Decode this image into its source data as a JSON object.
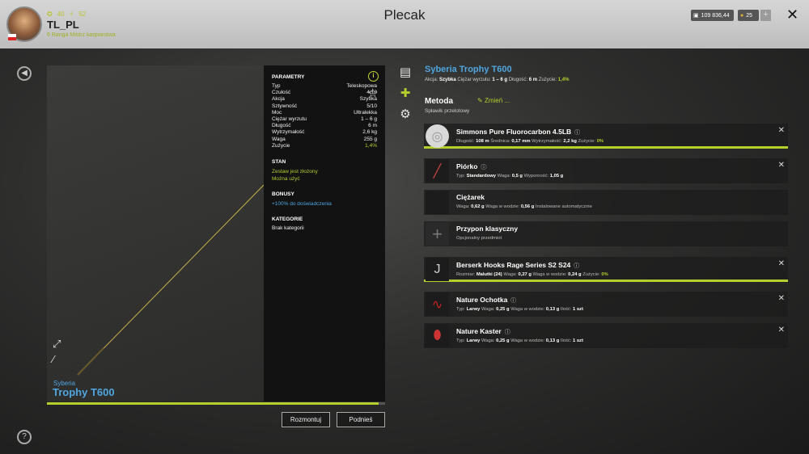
{
  "header": {
    "title": "Plecak",
    "username": "TL_PL",
    "level_stat": "40",
    "bolt_stat": "52",
    "rank": "6 Ranga Mistrz karpiarstwa",
    "money": "109 836,44",
    "gold": "25",
    "plus_label": "+",
    "close_label": "✕"
  },
  "preview": {
    "brand": "Syberia",
    "model": "Trophy T600",
    "durability_fraction": 0.98
  },
  "params": {
    "heading": "PARAMETRY",
    "rows": [
      {
        "label": "Typ",
        "value": "Teleskopowa"
      },
      {
        "label": "Czułość",
        "value": "4/10"
      },
      {
        "label": "Akcja",
        "value": "Szybka"
      },
      {
        "label": "Sztywność",
        "value": "5/10"
      },
      {
        "label": "Moc",
        "value": "Ultralekka"
      },
      {
        "label": "Ciężar wyrzutu",
        "value": "1 – 6 g"
      },
      {
        "label": "Długość",
        "value": "6 m"
      },
      {
        "label": "Wytrzymałość",
        "value": "2,6 kg"
      },
      {
        "label": "Waga",
        "value": "255 g"
      },
      {
        "label": "Zużycie",
        "value": "1,4%"
      }
    ],
    "stan_heading": "STAN",
    "stan_line1": "Zestaw jest złożony",
    "stan_line2": "Można użyć",
    "bonus_heading": "BONUSY",
    "bonus_line": "+100% do doświadczenia",
    "kategorie_heading": "KATEGORIE",
    "kategorie_line": "Brak kategorii"
  },
  "buttons": {
    "disassemble": "Rozmontuj",
    "pickup": "Podnieś"
  },
  "details": {
    "rod_name": "Syberia Trophy T600",
    "stats": [
      {
        "label": "Akcja:",
        "value": "Szybka"
      },
      {
        "label": "Ciężar wyrzutu:",
        "value": "1 – 6 g"
      },
      {
        "label": "Długość:",
        "value": "6 m"
      },
      {
        "label": "Zużycie:",
        "value": "1,4%"
      }
    ],
    "metoda_label": "Metoda",
    "change_label": "Zmień ...",
    "metoda_value": "Spławik przelotowy"
  },
  "slots": [
    {
      "name": "Simmons Pure Fluorocarbon 4.5LB",
      "details": [
        [
          "Długość:",
          "108 m"
        ],
        [
          "Średnica:",
          "0,17 mm"
        ],
        [
          "Wytrzymałość:",
          "2,2 kg"
        ],
        [
          "Zużycie:",
          "0%"
        ]
      ],
      "removable": true,
      "icon": "line-spool-icon"
    },
    {
      "name": "Piórko",
      "details": [
        [
          "Typ:",
          "Standardowy"
        ],
        [
          "Waga:",
          "0,5 g"
        ],
        [
          "Wyporność:",
          "1,05 g"
        ]
      ],
      "removable": true,
      "icon": "float-icon"
    },
    {
      "name": "Ciężarek",
      "details": [
        [
          "Waga:",
          "0,62 g"
        ],
        [
          "Waga w wodzie:",
          "0,56 g"
        ],
        [
          "Instalowane automatycznie",
          ""
        ]
      ],
      "removable": false,
      "icon": "sinker-icon"
    },
    {
      "name": "Przypon klasyczny",
      "details": [
        [
          "Opcjonalny przedmiot",
          ""
        ]
      ],
      "removable": false,
      "icon": "plus-icon"
    },
    {
      "name": "Berserk Hooks Rage Series S2 S24",
      "details": [
        [
          "Rozmiar:",
          "Malutki (24)"
        ],
        [
          "Waga:",
          "0,27 g"
        ],
        [
          "Waga w wodzie:",
          "0,24 g"
        ],
        [
          "Zużycie:",
          "0%"
        ]
      ],
      "removable": true,
      "icon": "hook-icon"
    },
    {
      "name": "Nature Ochotka",
      "details": [
        [
          "Typ:",
          "Larwy"
        ],
        [
          "Waga:",
          "0,25 g"
        ],
        [
          "Waga w wodzie:",
          "0,13 g"
        ],
        [
          "Ilość:",
          "1 szt"
        ]
      ],
      "removable": true,
      "icon": "bloodworm-icon"
    },
    {
      "name": "Nature Kaster",
      "details": [
        [
          "Typ:",
          "Larwy"
        ],
        [
          "Waga:",
          "0,25 g"
        ],
        [
          "Waga w wodzie:",
          "0,13 g"
        ],
        [
          "Ilość:",
          "1 szt"
        ]
      ],
      "removable": true,
      "icon": "caster-icon"
    }
  ],
  "colors": {
    "accent": "#b6cf2c",
    "link": "#4fa6e0"
  }
}
